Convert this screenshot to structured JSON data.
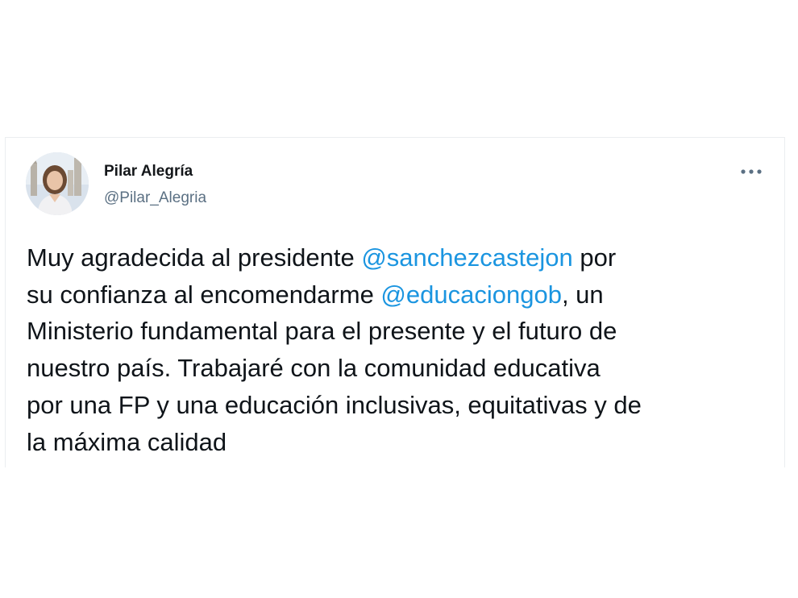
{
  "author": {
    "name": "Pilar Alegría",
    "handle": "@Pilar_Alegria"
  },
  "menu": {
    "icon": "more-horizontal-icon"
  },
  "tweet": {
    "line1_a": "Muy agradecida al presidente ",
    "mention1": "@sanchezcastejon",
    "line1_b": " por",
    "line2_a": "su confianza al encomendarme ",
    "mention2": "@educaciongob",
    "line2_b": ", un",
    "line3": "Ministerio fundamental para el presente y el futuro de",
    "line4": "nuestro país. Trabajaré con la comunidad educativa",
    "line5": "por una FP y una educación inclusivas, equitativas y de",
    "line6": "la máxima calidad"
  },
  "colors": {
    "mention": "#1b95e0",
    "text": "#0f1419",
    "handle": "#5b7083",
    "border": "#ebeef0"
  }
}
